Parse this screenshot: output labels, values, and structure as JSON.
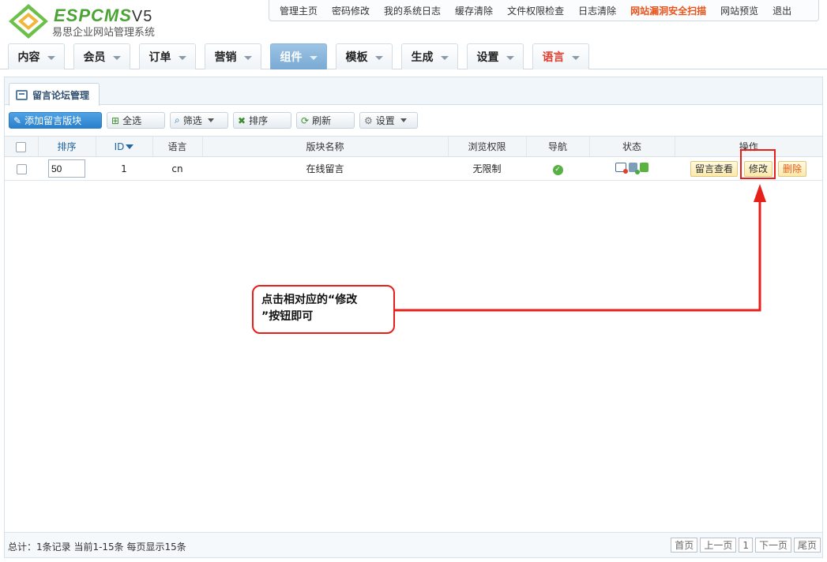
{
  "logo": {
    "name": "ESPCMS",
    "version": "V5",
    "subtitle": "易思企业网站管理系统"
  },
  "top_links": [
    {
      "label": "管理主页"
    },
    {
      "label": "密码修改"
    },
    {
      "label": "我的系统日志"
    },
    {
      "label": "缓存清除"
    },
    {
      "label": "文件权限检查"
    },
    {
      "label": "日志清除"
    },
    {
      "label": "网站漏洞安全扫描",
      "warn": true
    },
    {
      "label": "网站预览"
    },
    {
      "label": "退出"
    }
  ],
  "nav_tabs": [
    "内容",
    "会员",
    "订单",
    "营销",
    "组件",
    "模板",
    "生成",
    "设置",
    "语言"
  ],
  "nav_active": "组件",
  "panel": {
    "title": "留言论坛管理"
  },
  "toolbar": {
    "add": "添加留言版块",
    "select_all": "全选",
    "filter": "筛选",
    "sort": "排序",
    "refresh": "刷新",
    "settings": "设置"
  },
  "table": {
    "headers": {
      "sort": "排序",
      "id": "ID",
      "lang": "语言",
      "name": "版块名称",
      "perm": "浏览权限",
      "nav": "导航",
      "status": "状态",
      "ops": "操作"
    },
    "rows": [
      {
        "sort": "50",
        "id": "1",
        "lang": "cn",
        "name": "在线留言",
        "perm": "无限制",
        "ops": {
          "view": "留言查看",
          "edit": "修改",
          "delete": "删除"
        }
      }
    ]
  },
  "footer": {
    "stats": "总计：1条记录 当前1-15条 每页显示15条",
    "pager": {
      "first": "首页",
      "prev": "上一页",
      "current": "1",
      "next": "下一页",
      "last": "尾页"
    }
  },
  "annotation": {
    "line1": "点击相对应的“修改",
    "line2": "”按钮即可"
  },
  "colors": {
    "accent": "#2a7fcb",
    "annotation": "#e71f19",
    "logo_green": "#4aa334"
  }
}
